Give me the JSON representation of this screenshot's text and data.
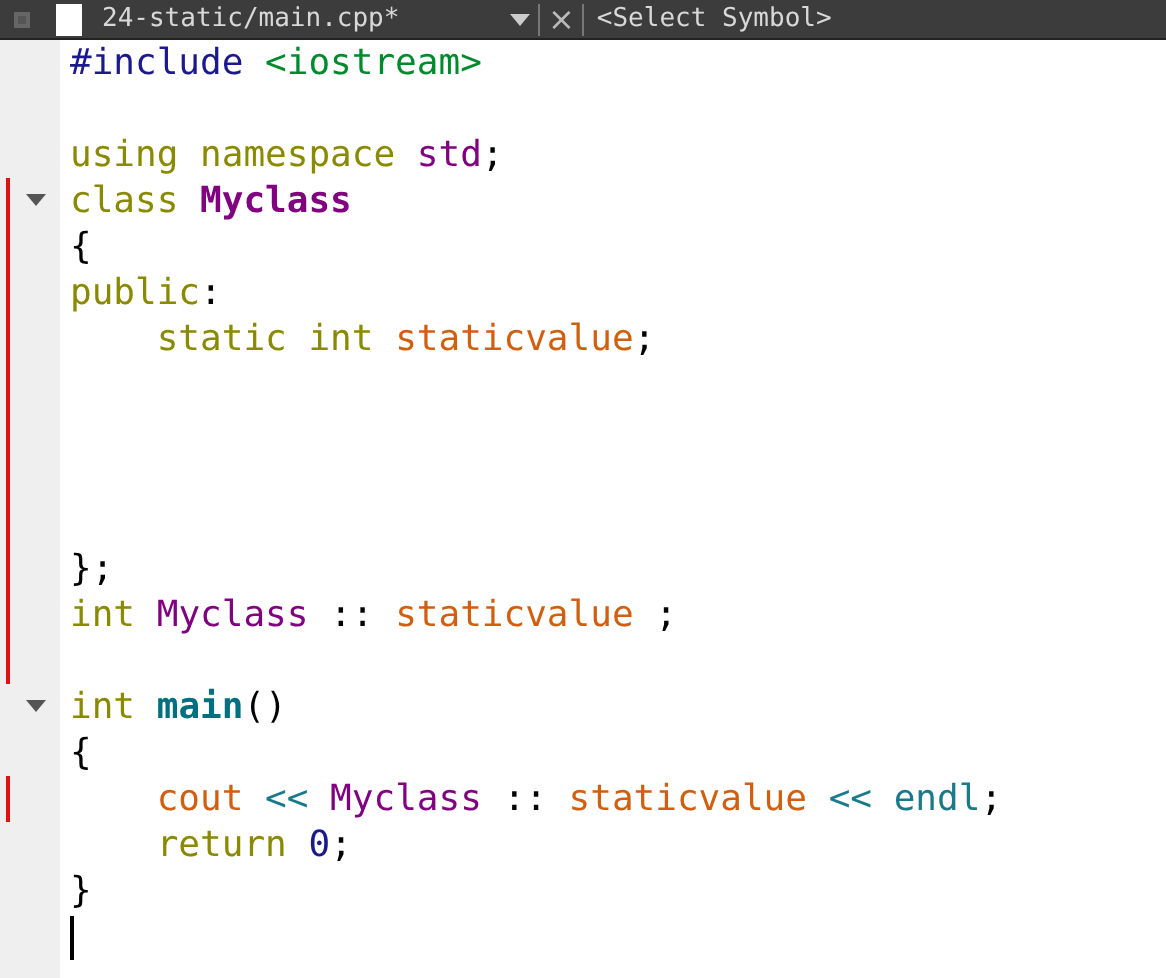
{
  "tab_bar": {
    "file_name": "24-static/main.cpp*",
    "close_glyph": "×",
    "symbol_picker": "<Select Symbol>"
  },
  "lines": [
    {
      "changed": false,
      "foldable": false,
      "cursor": false,
      "tokens": [
        {
          "text": "#include",
          "kind": "pre"
        },
        {
          "text": " <iostream>",
          "kind": "str"
        }
      ]
    },
    {
      "changed": false,
      "foldable": false,
      "cursor": false
    },
    {
      "changed": false,
      "foldable": false,
      "cursor": false,
      "tokens": [
        {
          "text": "using",
          "kind": "kw"
        },
        {
          "text": " namespace",
          "kind": "kw"
        },
        {
          "text": " std",
          "kind": "type"
        },
        {
          "text": ";",
          "kind": "plain"
        }
      ]
    },
    {
      "changed": true,
      "foldable": true,
      "cursor": false,
      "tokens": [
        {
          "text": "class",
          "kind": "kw"
        },
        {
          "text": " Myclass",
          "kind": "typedef"
        }
      ]
    },
    {
      "changed": true,
      "foldable": false,
      "cursor": false,
      "tokens": [
        {
          "text": "{",
          "kind": "plain"
        }
      ]
    },
    {
      "changed": true,
      "foldable": false,
      "cursor": false,
      "tokens": [
        {
          "text": "public",
          "kind": "kw"
        },
        {
          "text": ":",
          "kind": "plain"
        }
      ]
    },
    {
      "changed": true,
      "foldable": false,
      "cursor": false,
      "tokens": [
        {
          "text": "    static",
          "kind": "kw"
        },
        {
          "text": " int",
          "kind": "kw"
        },
        {
          "text": " staticvalue",
          "kind": "var"
        },
        {
          "text": ";",
          "kind": "plain"
        }
      ]
    },
    {
      "changed": true,
      "foldable": false,
      "cursor": false
    },
    {
      "changed": true,
      "foldable": false,
      "cursor": false
    },
    {
      "changed": true,
      "foldable": false,
      "cursor": false
    },
    {
      "changed": true,
      "foldable": false,
      "cursor": false
    },
    {
      "changed": true,
      "foldable": false,
      "cursor": false,
      "tokens": [
        {
          "text": "};",
          "kind": "plain"
        }
      ]
    },
    {
      "changed": true,
      "foldable": false,
      "cursor": false,
      "tokens": [
        {
          "text": "int",
          "kind": "kw"
        },
        {
          "text": " Myclass",
          "kind": "type"
        },
        {
          "text": " ::",
          "kind": "plain"
        },
        {
          "text": " staticvalue",
          "kind": "var"
        },
        {
          "text": " ;",
          "kind": "plain"
        }
      ]
    },
    {
      "changed": true,
      "foldable": false,
      "cursor": false
    },
    {
      "changed": false,
      "foldable": true,
      "cursor": false,
      "tokens": [
        {
          "text": "int",
          "kind": "kw"
        },
        {
          "text": " main",
          "kind": "func"
        },
        {
          "text": "()",
          "kind": "plain"
        }
      ]
    },
    {
      "changed": false,
      "foldable": false,
      "cursor": false,
      "tokens": [
        {
          "text": "{",
          "kind": "plain"
        }
      ]
    },
    {
      "changed": true,
      "foldable": false,
      "cursor": false,
      "tokens": [
        {
          "text": "    cout",
          "kind": "var"
        },
        {
          "text": " <<",
          "kind": "op"
        },
        {
          "text": " Myclass",
          "kind": "type"
        },
        {
          "text": " ::",
          "kind": "plain"
        },
        {
          "text": " staticvalue",
          "kind": "var"
        },
        {
          "text": " <<",
          "kind": "op"
        },
        {
          "text": " endl",
          "kind": "op"
        },
        {
          "text": ";",
          "kind": "plain"
        }
      ]
    },
    {
      "changed": false,
      "foldable": false,
      "cursor": false,
      "tokens": [
        {
          "text": "    return",
          "kind": "kw"
        },
        {
          "text": " 0",
          "kind": "num"
        },
        {
          "text": ";",
          "kind": "plain"
        }
      ]
    },
    {
      "changed": false,
      "foldable": false,
      "cursor": false,
      "tokens": [
        {
          "text": "}",
          "kind": "plain"
        }
      ]
    },
    {
      "changed": false,
      "foldable": false,
      "cursor": true
    }
  ]
}
